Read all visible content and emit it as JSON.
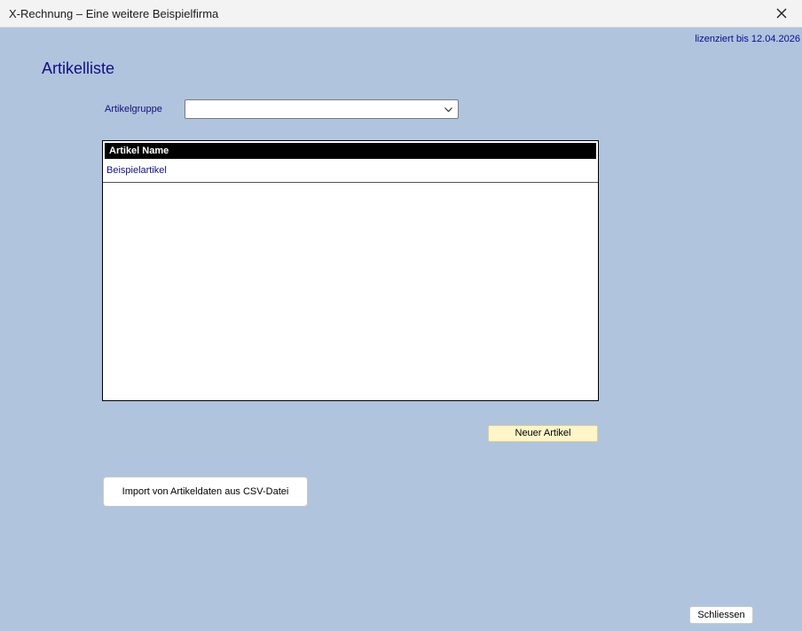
{
  "window": {
    "title": "X-Rechnung – Eine weitere Beispielfirma"
  },
  "license": "lizenziert bis 12.04.2026",
  "page": {
    "title": "Artikelliste"
  },
  "filter": {
    "label": "Artikelgruppe",
    "selected": ""
  },
  "list": {
    "header": "Artikel Name",
    "items": [
      "Beispielartikel"
    ]
  },
  "buttons": {
    "new_article": "Neuer Artikel",
    "import_csv": "Import von Artikeldaten aus CSV-Datei",
    "close": "Schliessen"
  },
  "colors": {
    "background": "#b0c4de",
    "accent_text": "#101080",
    "new_button": "#fff5c8"
  }
}
